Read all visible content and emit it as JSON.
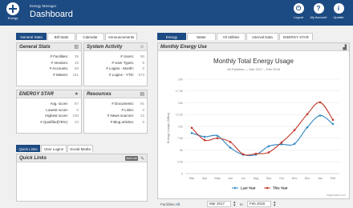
{
  "header": {
    "logo_label": "Energy",
    "app_subtitle": "Energy Manager",
    "app_title": "Dashboard",
    "buttons": [
      {
        "label": "Logout",
        "icon": "power-icon"
      },
      {
        "label": "My Account",
        "icon": "help-icon"
      },
      {
        "label": "Update",
        "icon": "info-icon"
      }
    ]
  },
  "left_tabs": [
    "General Stats",
    "Bill Stats",
    "Calendar",
    "Announcements"
  ],
  "right_tabs": [
    "Energy",
    "Water",
    "All Utilities",
    "Interval Data",
    "ENERGY STAR"
  ],
  "general_stats": {
    "title": "General Stats",
    "rows": [
      {
        "label": "# Facilities:",
        "value": "39"
      },
      {
        "label": "# Vendors:",
        "value": "15"
      },
      {
        "label": "# Accounts:",
        "value": "59"
      },
      {
        "label": "# Meters:",
        "value": "151"
      }
    ]
  },
  "system_activity": {
    "title": "System Activity",
    "rows": [
      {
        "label": "# Users:",
        "value": "90"
      },
      {
        "label": "# User Types:",
        "value": "9"
      },
      {
        "label": "# Logins - Month:",
        "value": "0"
      },
      {
        "label": "# Logins - YTD:",
        "value": "573"
      }
    ]
  },
  "energy_star": {
    "title": "ENERGY STAR",
    "rows": [
      {
        "label": "Avg. score:",
        "value": "87"
      },
      {
        "label": "Lowest score:",
        "value": "0"
      },
      {
        "label": "Highest score:",
        "value": "100"
      },
      {
        "label": "# Qualified(75%):",
        "value": "22"
      }
    ]
  },
  "resources": {
    "title": "Resources",
    "rows": [
      {
        "label": "# Documents:",
        "value": "91"
      },
      {
        "label": "# Links:",
        "value": "0"
      },
      {
        "label": "# News sources:",
        "value": "22"
      },
      {
        "label": "# Blog articles:",
        "value": "0"
      }
    ]
  },
  "bottom_tabs": [
    "Quick Links",
    "User Logins",
    "Social Media"
  ],
  "quick_links": {
    "title": "Quick Links",
    "add_label": "Add Link"
  },
  "monthly_energy": {
    "title": "Monthly Energy Use"
  },
  "chart_data": {
    "type": "line",
    "title": "Monthly Total Energy Usage",
    "subtitle": "All Facilities — Mar 2017 – Feb 2018",
    "ylabel": "Energy Usage (MBtu)",
    "xlabel": "",
    "categories": [
      "Mar",
      "Apr",
      "May",
      "Jun",
      "Jul",
      "Aug",
      "Sep",
      "Oct",
      "Nov",
      "Dec",
      "Jan",
      "Feb"
    ],
    "ylim": [
      0,
      20000
    ],
    "yticks": [
      "0",
      "2.5k",
      "5k",
      "7.5k",
      "10k",
      "12.5k",
      "15k",
      "17.5k",
      "20k"
    ],
    "series": [
      {
        "name": "Last Year",
        "color": "#2e86c1",
        "values": [
          8600,
          7800,
          8000,
          5500,
          4000,
          4000,
          5800,
          6200,
          6300,
          9800,
          12300,
          10500
        ]
      },
      {
        "name": "This Year",
        "color": "#c0392b",
        "values": [
          9700,
          7100,
          7500,
          6700,
          4100,
          4200,
          4500,
          6600,
          9200,
          12600,
          15100,
          11400
        ]
      }
    ],
    "legend": "bottom",
    "credit": "highcharts.com",
    "grid": true
  },
  "filter_bar": {
    "facilities_label": "Facilities:",
    "facilities_value": "All",
    "from_value": "Mar 2017",
    "to_label": "to",
    "to_value": "Feb 2018"
  },
  "colors": {
    "brand": "#1c4a82",
    "panel_header": "#e9e9e9"
  }
}
